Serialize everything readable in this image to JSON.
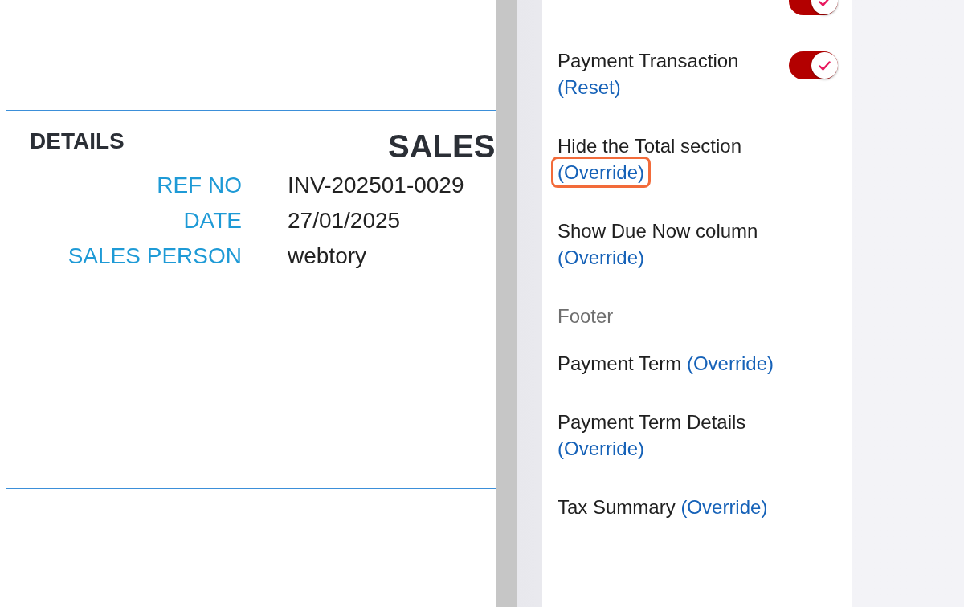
{
  "document": {
    "heading": "DETAILS",
    "title": "SALES",
    "fields": [
      {
        "label": "REF NO",
        "value": "INV-202501-0029"
      },
      {
        "label": "DATE",
        "value": "27/01/2025"
      },
      {
        "label": "SALES PERSON",
        "value": "webtory"
      }
    ]
  },
  "settings_panel": {
    "items": [
      {
        "kind": "toggle_setting",
        "on": true
      },
      {
        "kind": "toggle_setting",
        "label": "Payment Transaction",
        "action": "(Reset)",
        "on": true,
        "highlighted": false
      },
      {
        "kind": "setting",
        "label": "Hide the Total section",
        "action": "(Override)",
        "highlighted": true
      },
      {
        "kind": "setting",
        "label": "Show Due Now column",
        "action": "(Override)",
        "highlighted": false
      },
      {
        "kind": "section_header",
        "label": "Footer"
      },
      {
        "kind": "setting",
        "label": "Payment Term",
        "action": "(Override)",
        "highlighted": false
      },
      {
        "kind": "setting",
        "label": "Payment Term Details",
        "action": "(Override)",
        "highlighted": false
      },
      {
        "kind": "setting",
        "label": "Tax Summary",
        "action": "(Override)",
        "highlighted": false
      }
    ]
  }
}
